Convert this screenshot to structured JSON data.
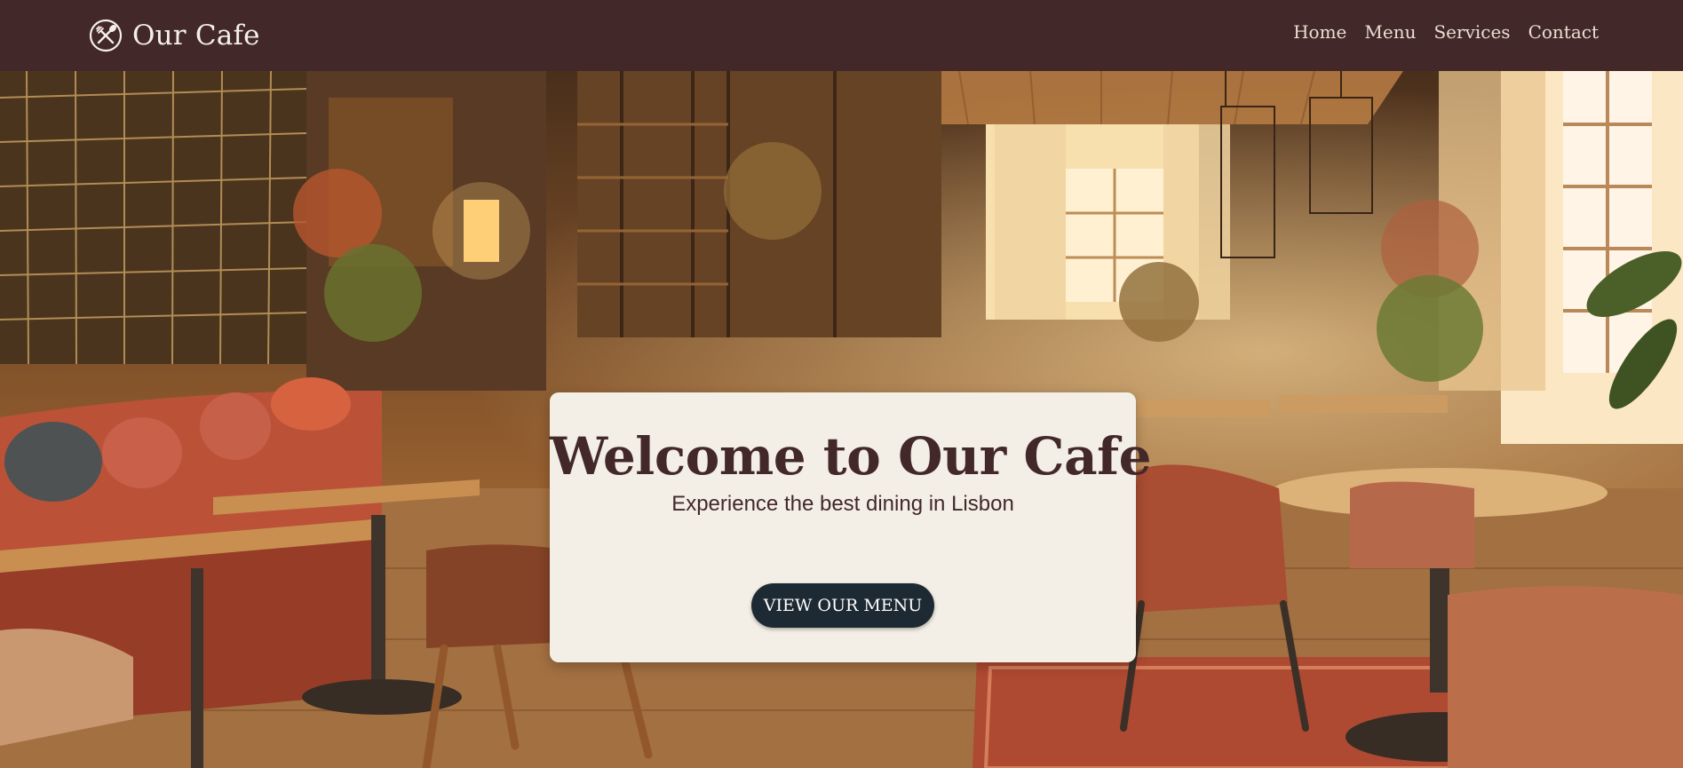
{
  "brand": {
    "name": "Our Cafe",
    "icon": "fork-spoon-icon"
  },
  "nav": {
    "items": [
      "Home",
      "Menu",
      "Services",
      "Contact"
    ]
  },
  "hero": {
    "title": "Welcome to Our Cafe",
    "subtitle": "Experience the best dining in Lisbon",
    "button_label": "VIEW OUR MENU"
  },
  "colors": {
    "navbar": "#43282a",
    "card": "#f3efe6",
    "title": "#43282a",
    "button": "#1e2a33"
  }
}
